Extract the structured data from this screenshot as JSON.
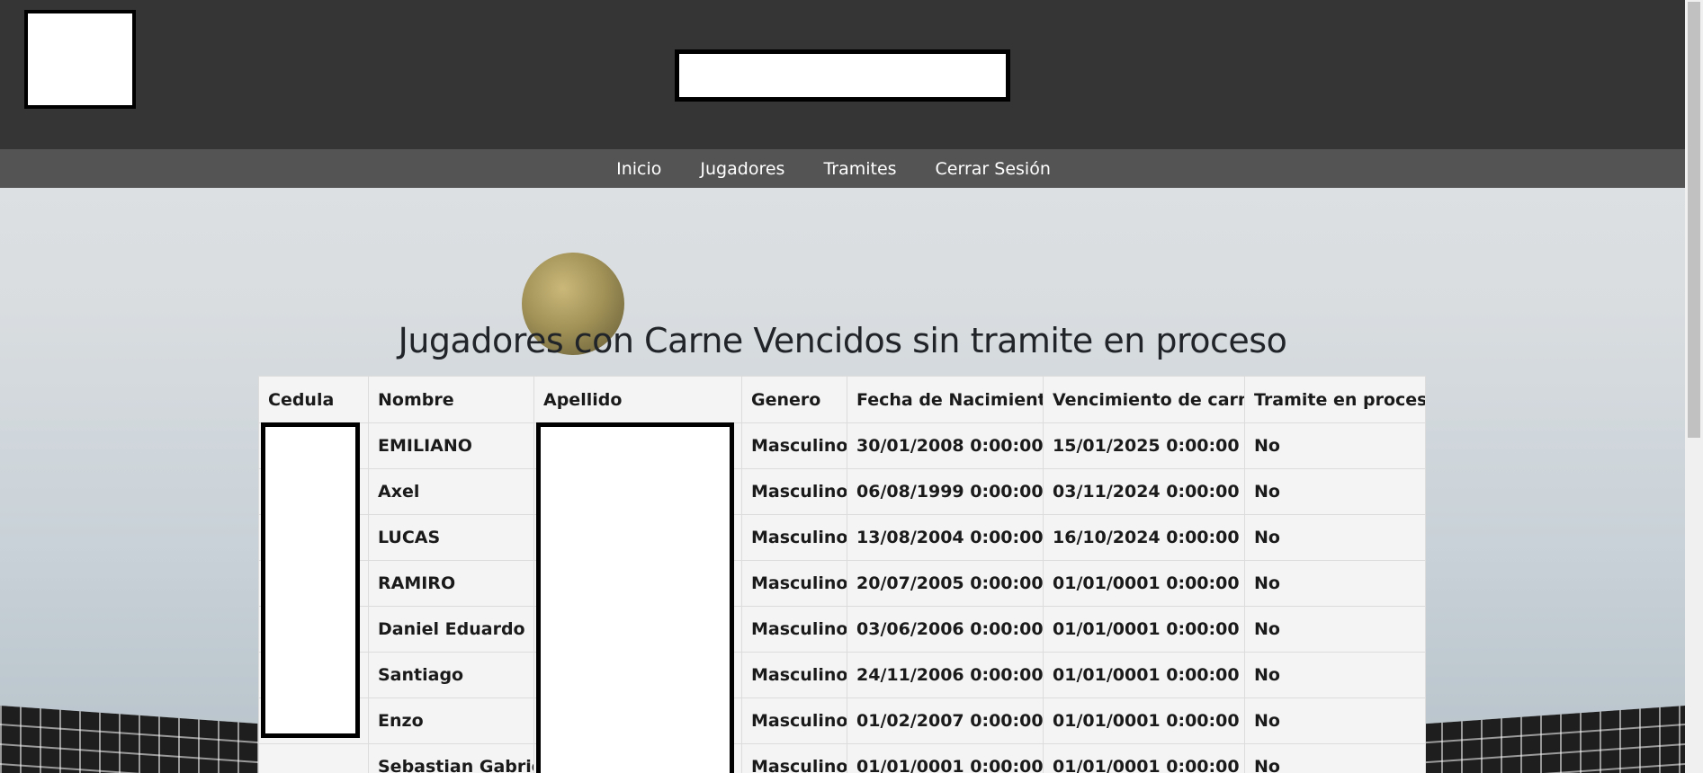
{
  "nav": {
    "items": [
      {
        "label": "Inicio"
      },
      {
        "label": "Jugadores"
      },
      {
        "label": "Tramites"
      },
      {
        "label": "Cerrar Sesión"
      }
    ]
  },
  "main": {
    "title": "Jugadores con Carne Vencidos sin tramite en proceso",
    "table": {
      "headers": [
        "Cedula",
        "Nombre",
        "Apellido",
        "Genero",
        "Fecha de Nacimiento",
        "Vencimiento de carne",
        "Tramite en proceso"
      ],
      "rows": [
        {
          "cedula": "",
          "nombre": "EMILIANO",
          "apellido": "",
          "genero": "Masculino",
          "nacimiento": "30/01/2008 0:00:00",
          "vencimiento": "15/01/2025 0:00:00",
          "tramite": "No"
        },
        {
          "cedula": "",
          "nombre": "Axel",
          "apellido": "",
          "genero": "Masculino",
          "nacimiento": "06/08/1999 0:00:00",
          "vencimiento": "03/11/2024 0:00:00",
          "tramite": "No"
        },
        {
          "cedula": "",
          "nombre": "LUCAS",
          "apellido": "",
          "genero": "Masculino",
          "nacimiento": "13/08/2004 0:00:00",
          "vencimiento": "16/10/2024 0:00:00",
          "tramite": "No"
        },
        {
          "cedula": "",
          "nombre": "RAMIRO",
          "apellido": "",
          "genero": "Masculino",
          "nacimiento": "20/07/2005 0:00:00",
          "vencimiento": "01/01/0001 0:00:00",
          "tramite": "No"
        },
        {
          "cedula": "",
          "nombre": "Daniel Eduardo",
          "apellido": "",
          "genero": "Masculino",
          "nacimiento": "03/06/2006 0:00:00",
          "vencimiento": "01/01/0001 0:00:00",
          "tramite": "No"
        },
        {
          "cedula": "",
          "nombre": "Santiago",
          "apellido": "",
          "genero": "Masculino",
          "nacimiento": "24/11/2006 0:00:00",
          "vencimiento": "01/01/0001 0:00:00",
          "tramite": "No"
        },
        {
          "cedula": "",
          "nombre": "Enzo",
          "apellido": "",
          "genero": "Masculino",
          "nacimiento": "01/02/2007 0:00:00",
          "vencimiento": "01/01/0001 0:00:00",
          "tramite": "No"
        },
        {
          "cedula": "",
          "nombre": "Sebastian Gabriel",
          "apellido": "",
          "genero": "Masculino",
          "nacimiento": "01/01/0001 0:00:00",
          "vencimiento": "01/01/0001 0:00:00",
          "tramite": "No"
        }
      ]
    }
  },
  "colors": {
    "header_bg": "#353535",
    "navbar_bg": "#545454",
    "table_bg": "#f4f4f4"
  }
}
